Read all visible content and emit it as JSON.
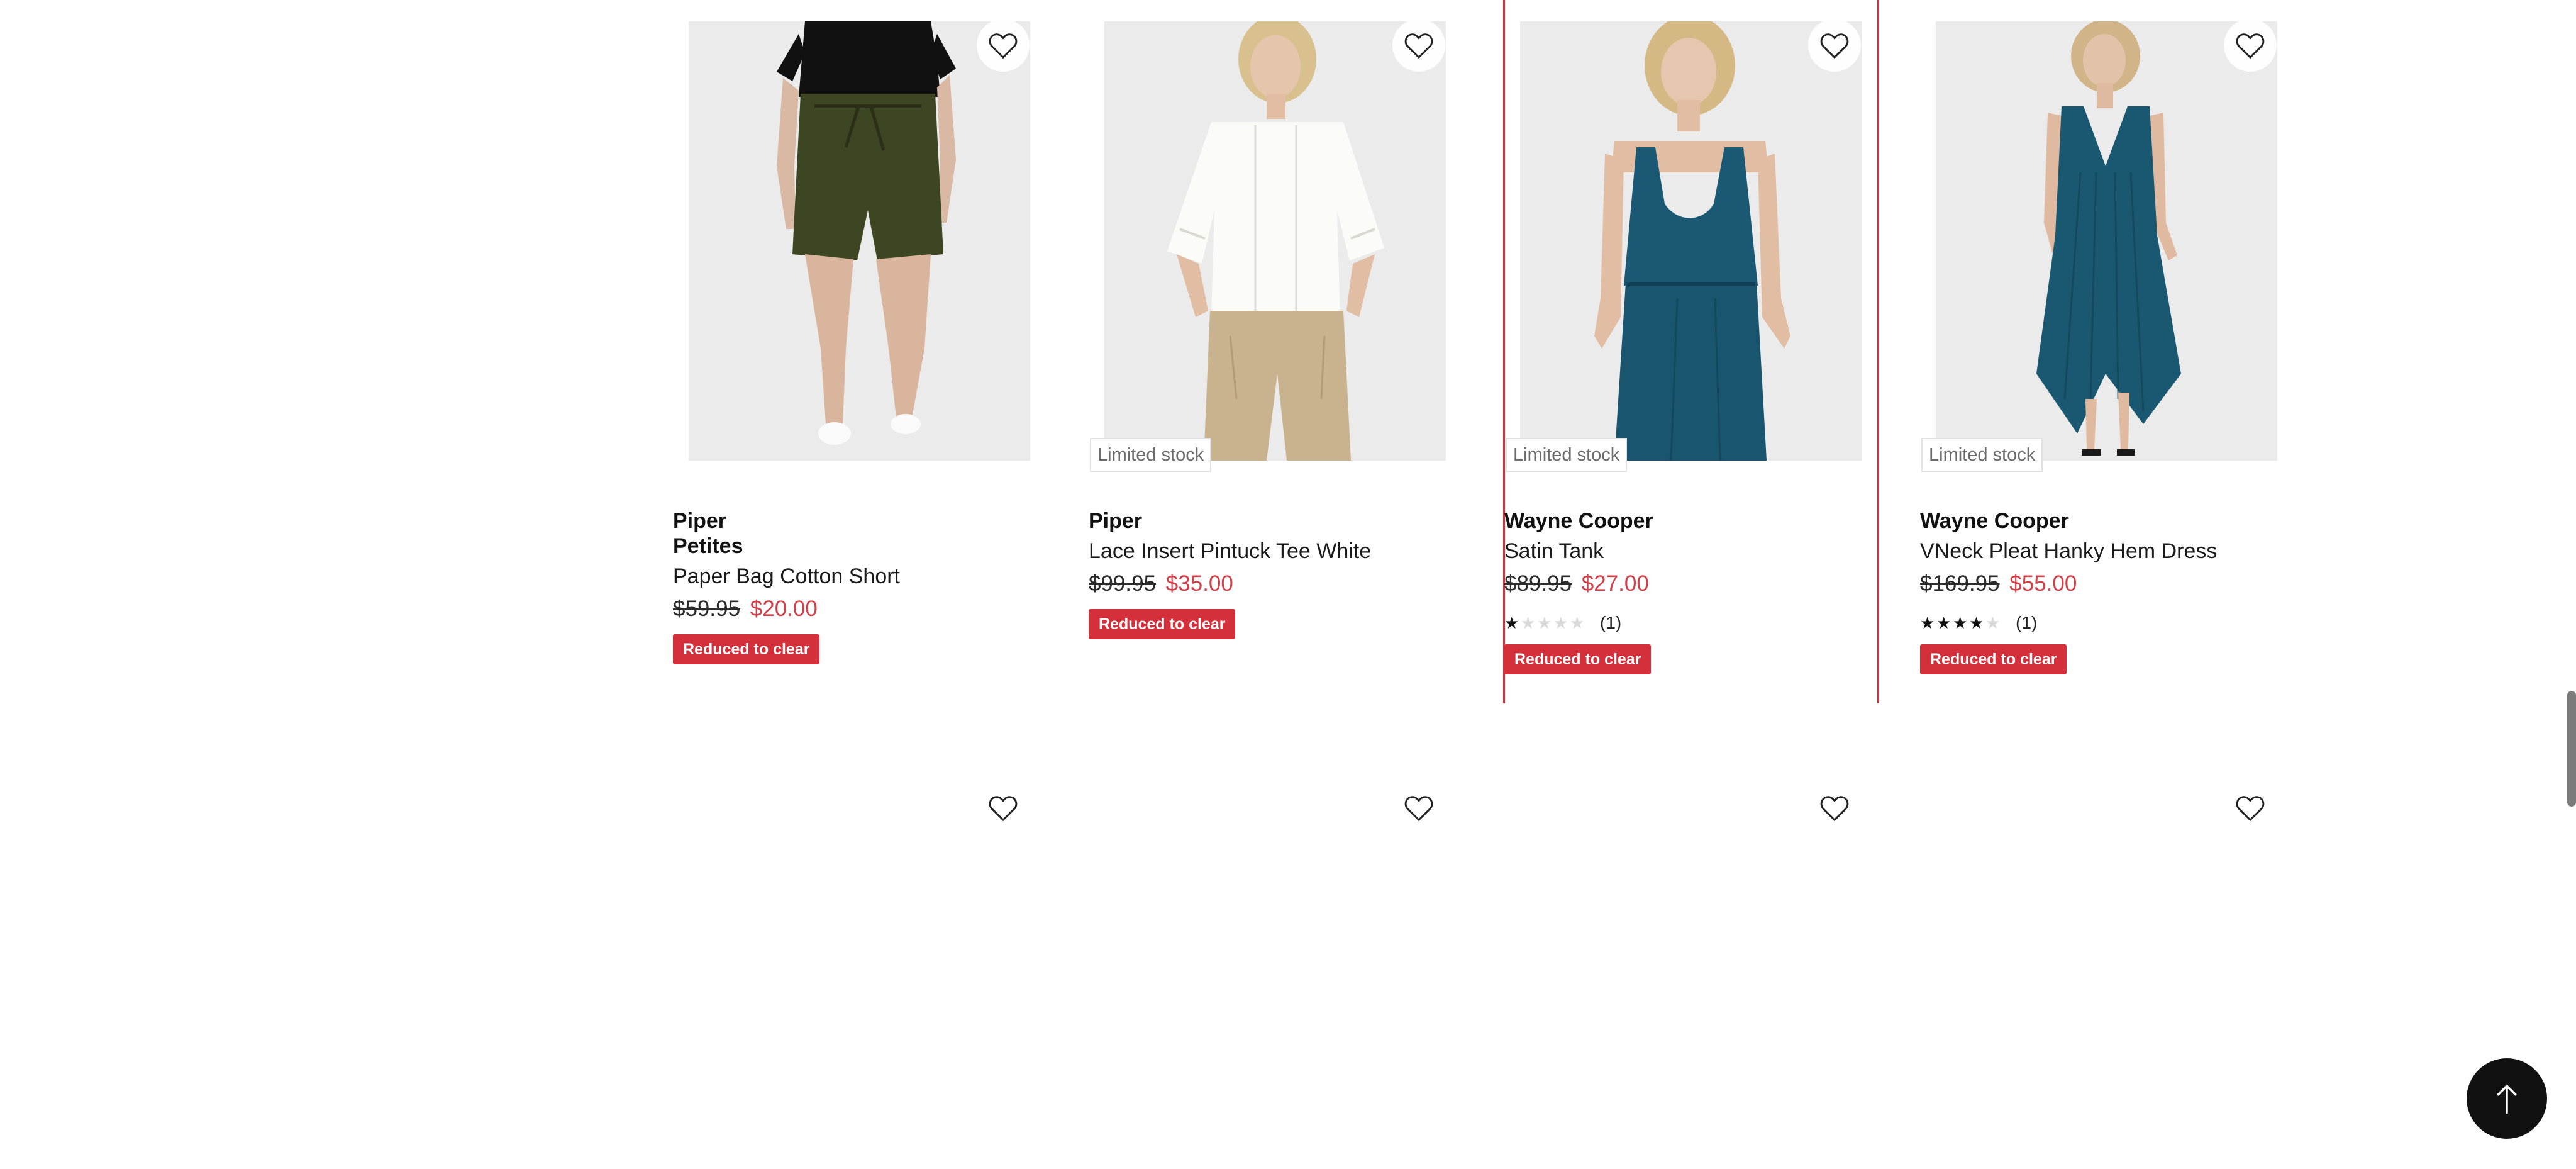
{
  "products": [
    {
      "brand": "Piper",
      "sub_brand": "Petites",
      "name": "Paper Bag Cotton Short",
      "was_price": "$59.95",
      "now_price": "$20.00",
      "sale_badge": "Reduced to clear",
      "image_icon": "product-photo-khaki-shorts"
    },
    {
      "brand": "Piper",
      "name": "Lace Insert Pintuck Tee White",
      "was_price": "$99.95",
      "now_price": "$35.00",
      "stock_badge": "Limited stock",
      "sale_badge": "Reduced to clear",
      "image_icon": "product-photo-white-tee"
    },
    {
      "brand": "Wayne Cooper",
      "name": "Satin Tank",
      "was_price": "$89.95",
      "now_price": "$27.00",
      "rating": 1,
      "rating_count": "(1)",
      "stock_badge": "Limited stock",
      "sale_badge": "Reduced to clear",
      "image_icon": "product-photo-teal-satin-tank"
    },
    {
      "brand": "Wayne Cooper",
      "name": "VNeck Pleat Hanky Hem Dress",
      "was_price": "$169.95",
      "now_price": "$55.00",
      "rating": 4,
      "rating_count": "(1)",
      "stock_badge": "Limited stock",
      "sale_badge": "Reduced to clear",
      "image_icon": "product-photo-teal-dress"
    }
  ],
  "icons": {
    "wishlist": "heart-outline-icon",
    "back_to_top": "arrow-up-icon"
  },
  "colors": {
    "sale_red": "#d3303b",
    "price_red": "#d0414a",
    "focus_outline": "#d0343e",
    "image_bg": "#ebebeb"
  }
}
